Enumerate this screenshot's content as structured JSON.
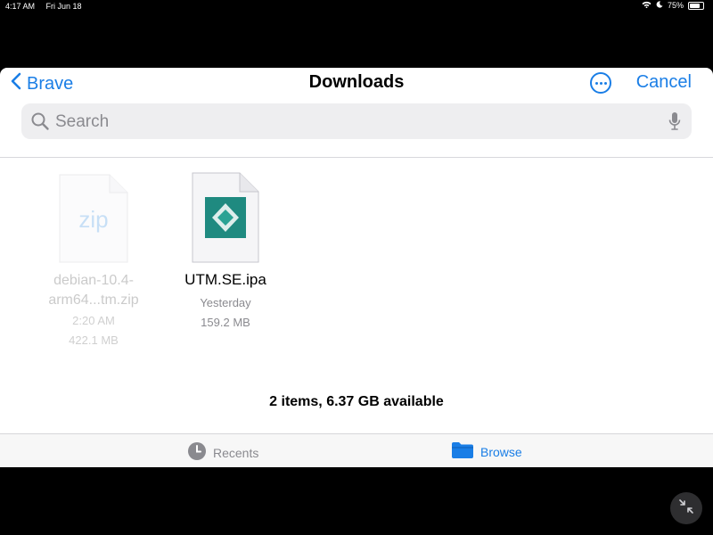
{
  "status_bar": {
    "time": "4:17 AM",
    "date": "Fri Jun 18",
    "battery": "75%"
  },
  "nav": {
    "back_label": "Brave",
    "title": "Downloads",
    "cancel_label": "Cancel"
  },
  "search": {
    "placeholder": "Search",
    "value": ""
  },
  "files": [
    {
      "icon_text": "zip",
      "name_line1": "debian-10.4-",
      "name_line2": "arm64...tm.zip",
      "date": "2:20 AM",
      "size": "422.1 MB"
    },
    {
      "name": "UTM.SE.ipa",
      "date": "Yesterday",
      "size": "159.2 MB"
    }
  ],
  "footer": {
    "summary": "2 items, 6.37 GB available"
  },
  "tabs": [
    {
      "label": "Recents",
      "icon": "clock-icon"
    },
    {
      "label": "Browse",
      "icon": "folder-icon"
    }
  ],
  "colors": {
    "accent": "#1a7ee6",
    "ipa_icon": "#1f8a80"
  }
}
